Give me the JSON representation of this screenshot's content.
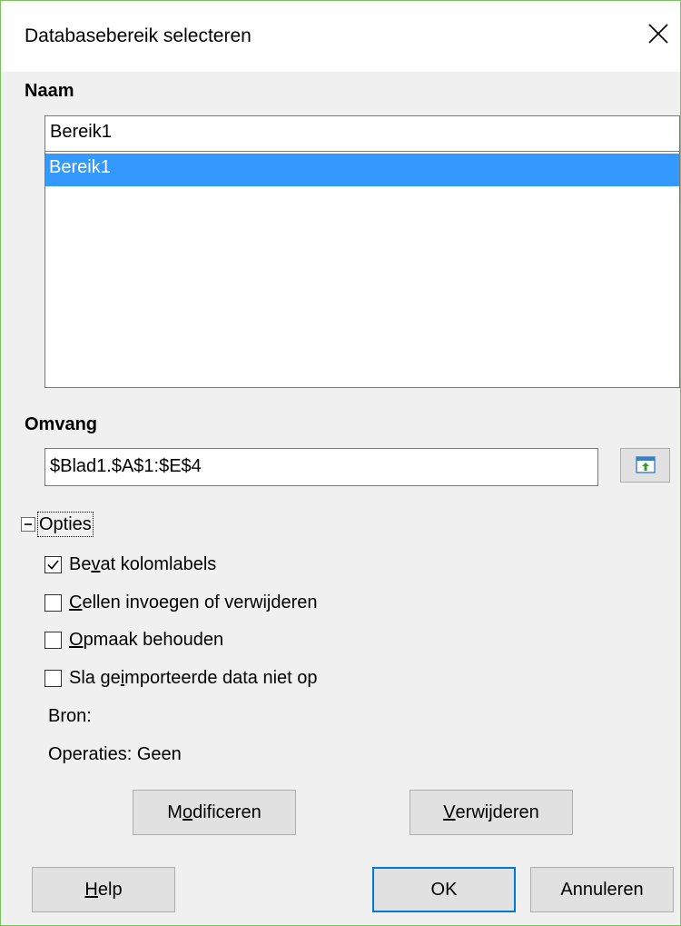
{
  "dialog": {
    "title": "Databasebereik selecteren"
  },
  "name_section": {
    "label": "Naam",
    "input_value": "Bereik1",
    "list_items": [
      "Bereik1"
    ]
  },
  "range_section": {
    "label": "Omvang",
    "input_value": "$Blad1.$A$1:$E$4"
  },
  "options": {
    "label": "Opties",
    "expanded": true,
    "checkboxes": [
      {
        "pre": "Be",
        "mn": "v",
        "post": "at kolomlabels",
        "checked": true
      },
      {
        "pre": "",
        "mn": "C",
        "post": "ellen invoegen of verwijderen",
        "checked": false
      },
      {
        "pre": "",
        "mn": "O",
        "post": "pmaak behouden",
        "checked": false
      },
      {
        "pre": "Sla ge",
        "mn": "i",
        "post": "mporteerde data niet op",
        "checked": false
      }
    ],
    "source_label": "Bron:",
    "operations_label": "Operaties: Geen"
  },
  "buttons": {
    "modify": {
      "pre": "M",
      "mn": "o",
      "post": "dificeren"
    },
    "delete": {
      "pre": "",
      "mn": "V",
      "post": "erwijderen"
    },
    "help": {
      "pre": "",
      "mn": "H",
      "post": "elp"
    },
    "ok": "OK",
    "cancel": "Annuleren"
  },
  "icons": {
    "close": "close-icon",
    "shrink": "shrink-dialog-icon",
    "expander": "collapse-icon",
    "check": "checkmark-icon"
  },
  "colors": {
    "selection": "#3399ff",
    "default_button_border": "#0078d7",
    "window_border": "#7ac25d"
  }
}
